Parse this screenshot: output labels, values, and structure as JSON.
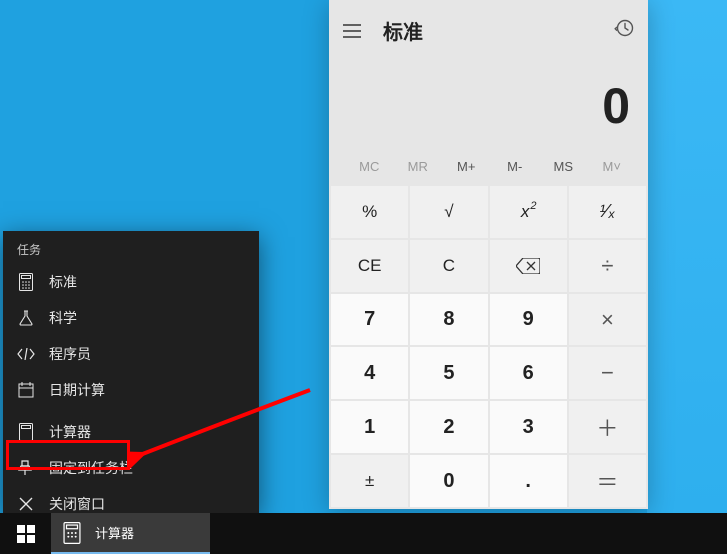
{
  "calculator": {
    "mode_title": "标准",
    "display_value": "0",
    "memory": {
      "mc": "MC",
      "mr": "MR",
      "mplus": "M+",
      "mminus": "M-",
      "ms": "MS",
      "mlist": "M˅"
    },
    "keys": {
      "percent": "%",
      "sqrt": "√",
      "square_base": "x",
      "square_exp": "2",
      "reciprocal": "¹⁄ₓ",
      "ce": "CE",
      "c": "C",
      "divide": "÷",
      "multiply": "×",
      "minus": "−",
      "plus": "＋",
      "equals": "＝",
      "plusminus": "±",
      "decimal": ".",
      "n7": "7",
      "n8": "8",
      "n9": "9",
      "n4": "4",
      "n5": "5",
      "n6": "6",
      "n1": "1",
      "n2": "2",
      "n3": "3",
      "n0": "0"
    }
  },
  "jumplist": {
    "tasks_header": "任务",
    "items": {
      "standard": "标准",
      "scientific": "科学",
      "programmer": "程序员",
      "date": "日期计算"
    },
    "app_name": "计算器",
    "pin": "固定到任务栏",
    "close": "关闭窗口"
  },
  "taskbar": {
    "app_label": "计算器"
  }
}
